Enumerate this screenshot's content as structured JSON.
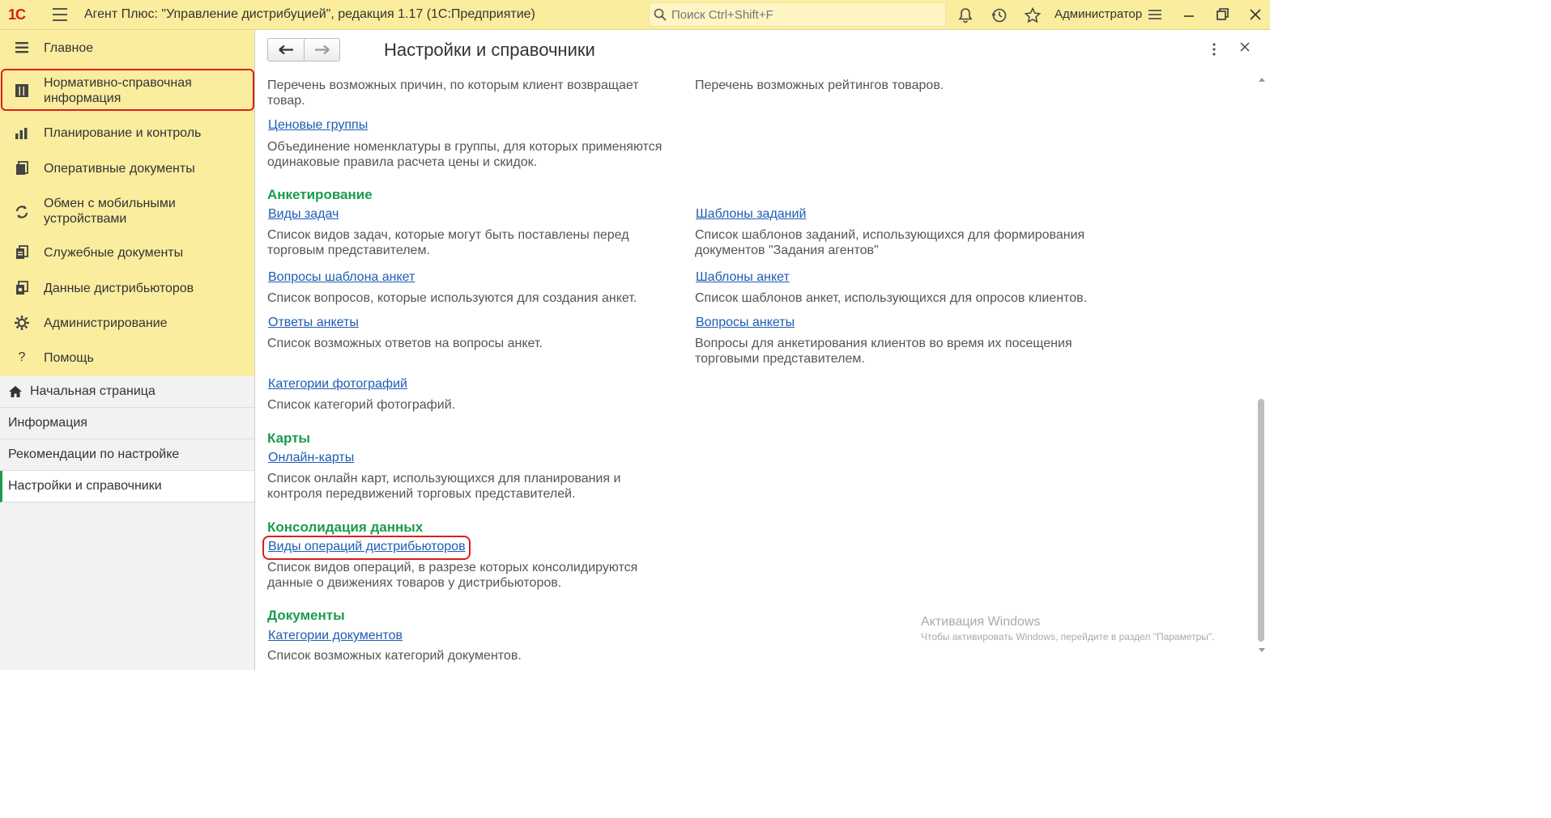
{
  "window": {
    "logo": "1С",
    "title": "Агент Плюс: \"Управление дистрибуцией\", редакция 1.17  (1С:Предприятие)",
    "search_placeholder": "Поиск Ctrl+Shift+F",
    "user": "Администратор"
  },
  "sidebar": {
    "sections": [
      {
        "label": "Главное",
        "icon": "menu-lines-icon"
      },
      {
        "label_line1": "Нормативно-справочная",
        "label_line2": "информация",
        "icon": "reference-grid-icon",
        "highlighted": true
      },
      {
        "label": "Планирование и контроль",
        "icon": "bar-chart-icon"
      },
      {
        "label": "Оперативные документы",
        "icon": "documents-icon"
      },
      {
        "label_line1": "Обмен с мобильными",
        "label_line2": "устройствами",
        "icon": "sync-icon"
      },
      {
        "label": "Служебные документы",
        "icon": "service-docs-icon"
      },
      {
        "label": "Данные дистрибьюторов",
        "icon": "distributor-data-icon"
      },
      {
        "label": "Администрирование",
        "icon": "gear-icon"
      },
      {
        "label": "Помощь",
        "icon": "question-icon"
      }
    ],
    "open_pages": [
      {
        "label": "Начальная страница",
        "icon": "home-icon"
      },
      {
        "label": "Информация"
      },
      {
        "label": "Рекомендации по настройке"
      },
      {
        "label": "Настройки и справочники",
        "active": true
      }
    ]
  },
  "main": {
    "title": "Настройки и справочники",
    "top_partial": {
      "left_desc": "Перечень возможных причин, по которым клиент возвращает товар.",
      "right_desc": "Перечень возможных рейтингов товаров."
    },
    "price_groups": {
      "link": "Ценовые группы",
      "desc": "Объединение номенклатуры в группы, для которых применяются одинаковые правила расчета цены и скидок."
    },
    "groups": {
      "survey": {
        "title": "Анкетирование",
        "items": [
          {
            "link": "Виды задач",
            "desc": "Список видов задач, которые могут быть поставлены перед торговым представителем."
          },
          {
            "link": "Шаблоны заданий",
            "desc": "Список шаблонов заданий, использующихся для формирования документов \"Задания агентов\""
          },
          {
            "link": "Вопросы шаблона анкет",
            "desc": "Список вопросов, которые используются для создания анкет."
          },
          {
            "link": "Шаблоны анкет",
            "desc": "Список шаблонов анкет, использующихся для опросов клиентов."
          },
          {
            "link": "Ответы анкеты",
            "desc": "Список возможных ответов на вопросы анкет."
          },
          {
            "link": "Вопросы анкеты",
            "desc": "Вопросы для анкетирования клиентов во время их посещения торговыми представителем."
          },
          {
            "link": "Категории фотографий",
            "desc": "Список категорий фотографий."
          }
        ]
      },
      "maps": {
        "title": "Карты",
        "items": [
          {
            "link": "Онлайн-карты",
            "desc": "Список онлайн карт, использующихся для планирования и контроля передвижений торговых представителей."
          }
        ]
      },
      "consolidation": {
        "title": "Консолидация данных",
        "items": [
          {
            "link": "Виды операций дистрибьюторов",
            "desc": "Список видов операций, в разрезе которых консолидируются данные о движениях товаров у дистрибьюторов."
          }
        ]
      },
      "documents": {
        "title": "Документы",
        "items": [
          {
            "link": "Категории документов",
            "desc": "Список возможных категорий документов."
          }
        ]
      }
    }
  },
  "watermark": {
    "line1": "Активация Windows",
    "line2": "Чтобы активировать Windows, перейдите в раздел \"Параметры\"."
  },
  "colors": {
    "topbar": "#fbed9e",
    "group_title": "#1a9c4e",
    "link": "#1e5cb3",
    "highlight": "#d9201e"
  }
}
